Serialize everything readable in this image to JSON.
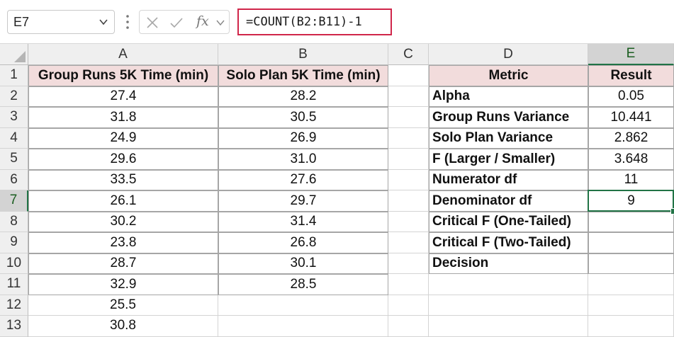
{
  "formula_bar": {
    "name_box": "E7",
    "fx_label": "fx",
    "formula": "=COUNT(B2:B11)-1"
  },
  "sheet": {
    "columns": [
      "A",
      "B",
      "C",
      "D",
      "E"
    ],
    "rows": [
      "1",
      "2",
      "3",
      "4",
      "5",
      "6",
      "7",
      "8",
      "9",
      "10",
      "11",
      "12",
      "13"
    ],
    "active_cell": "E7",
    "data": {
      "A1": "Group Runs 5K Time (min)",
      "B1": "Solo Plan 5K Time (min)",
      "D1": "Metric",
      "E1": "Result",
      "A2": "27.4",
      "B2": "28.2",
      "D2": "Alpha",
      "E2": "0.05",
      "A3": "31.8",
      "B3": "30.5",
      "D3": "Group Runs Variance",
      "E3": "10.441",
      "A4": "24.9",
      "B4": "26.9",
      "D4": "Solo Plan Variance",
      "E4": "2.862",
      "A5": "29.6",
      "B5": "31.0",
      "D5": "F (Larger / Smaller)",
      "E5": "3.648",
      "A6": "33.5",
      "B6": "27.6",
      "D6": "Numerator df",
      "E6": "11",
      "A7": "26.1",
      "B7": "29.7",
      "D7": "Denominator df",
      "E7": "9",
      "A8": "30.2",
      "B8": "31.4",
      "D8": "Critical F (One-Tailed)",
      "E8": "",
      "A9": "23.8",
      "B9": "26.8",
      "D9": "Critical F (Two-Tailed)",
      "E9": "",
      "A10": "28.7",
      "B10": "30.1",
      "D10": "Decision",
      "E10": "",
      "A11": "32.9",
      "B11": "28.5",
      "A12": "25.5",
      "A13": "30.8"
    }
  },
  "colors": {
    "header_fill": "#f2dcdc",
    "selection_green": "#217346",
    "formula_highlight": "#d0264a"
  }
}
